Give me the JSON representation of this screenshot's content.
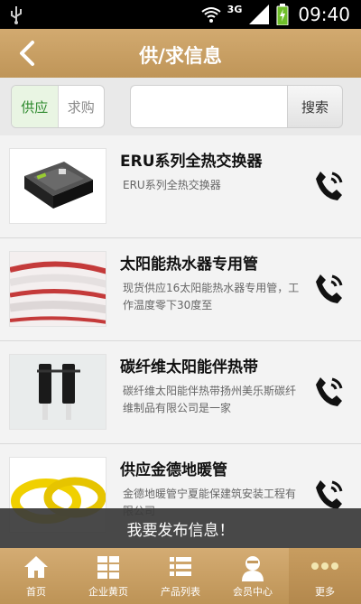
{
  "status_bar": {
    "network": "3G",
    "time": "09:40"
  },
  "header": {
    "title": "供/求信息"
  },
  "filter": {
    "supply_label": "供应",
    "demand_label": "求购",
    "search_placeholder": "",
    "search_button": "搜索"
  },
  "items": [
    {
      "title": "ERU系列全热交换器",
      "desc": "ERU系列全热交换器"
    },
    {
      "title": "太阳能热水器专用管",
      "desc": "现货供应16太阳能热水器专用管，工作温度零下30度至"
    },
    {
      "title": "碳纤维太阳能伴热带",
      "desc": "碳纤维太阳能伴热带扬州美乐斯碳纤维制品有限公司是一家"
    },
    {
      "title": "供应金德地暖管",
      "desc": "金德地暖管宁夏能保建筑安装工程有限公司"
    }
  ],
  "banner": {
    "label": "我要发布信息！"
  },
  "tabs": [
    {
      "label": "首页",
      "icon": "home-icon"
    },
    {
      "label": "企业黄页",
      "icon": "grid-icon"
    },
    {
      "label": "产品列表",
      "icon": "list-icon"
    },
    {
      "label": "会员中心",
      "icon": "user-icon"
    },
    {
      "label": "更多",
      "icon": "more-icon"
    }
  ],
  "colors": {
    "header": "#c9a066",
    "tab_bar": "#c9a066",
    "supply_active": "#2e8a2e"
  }
}
